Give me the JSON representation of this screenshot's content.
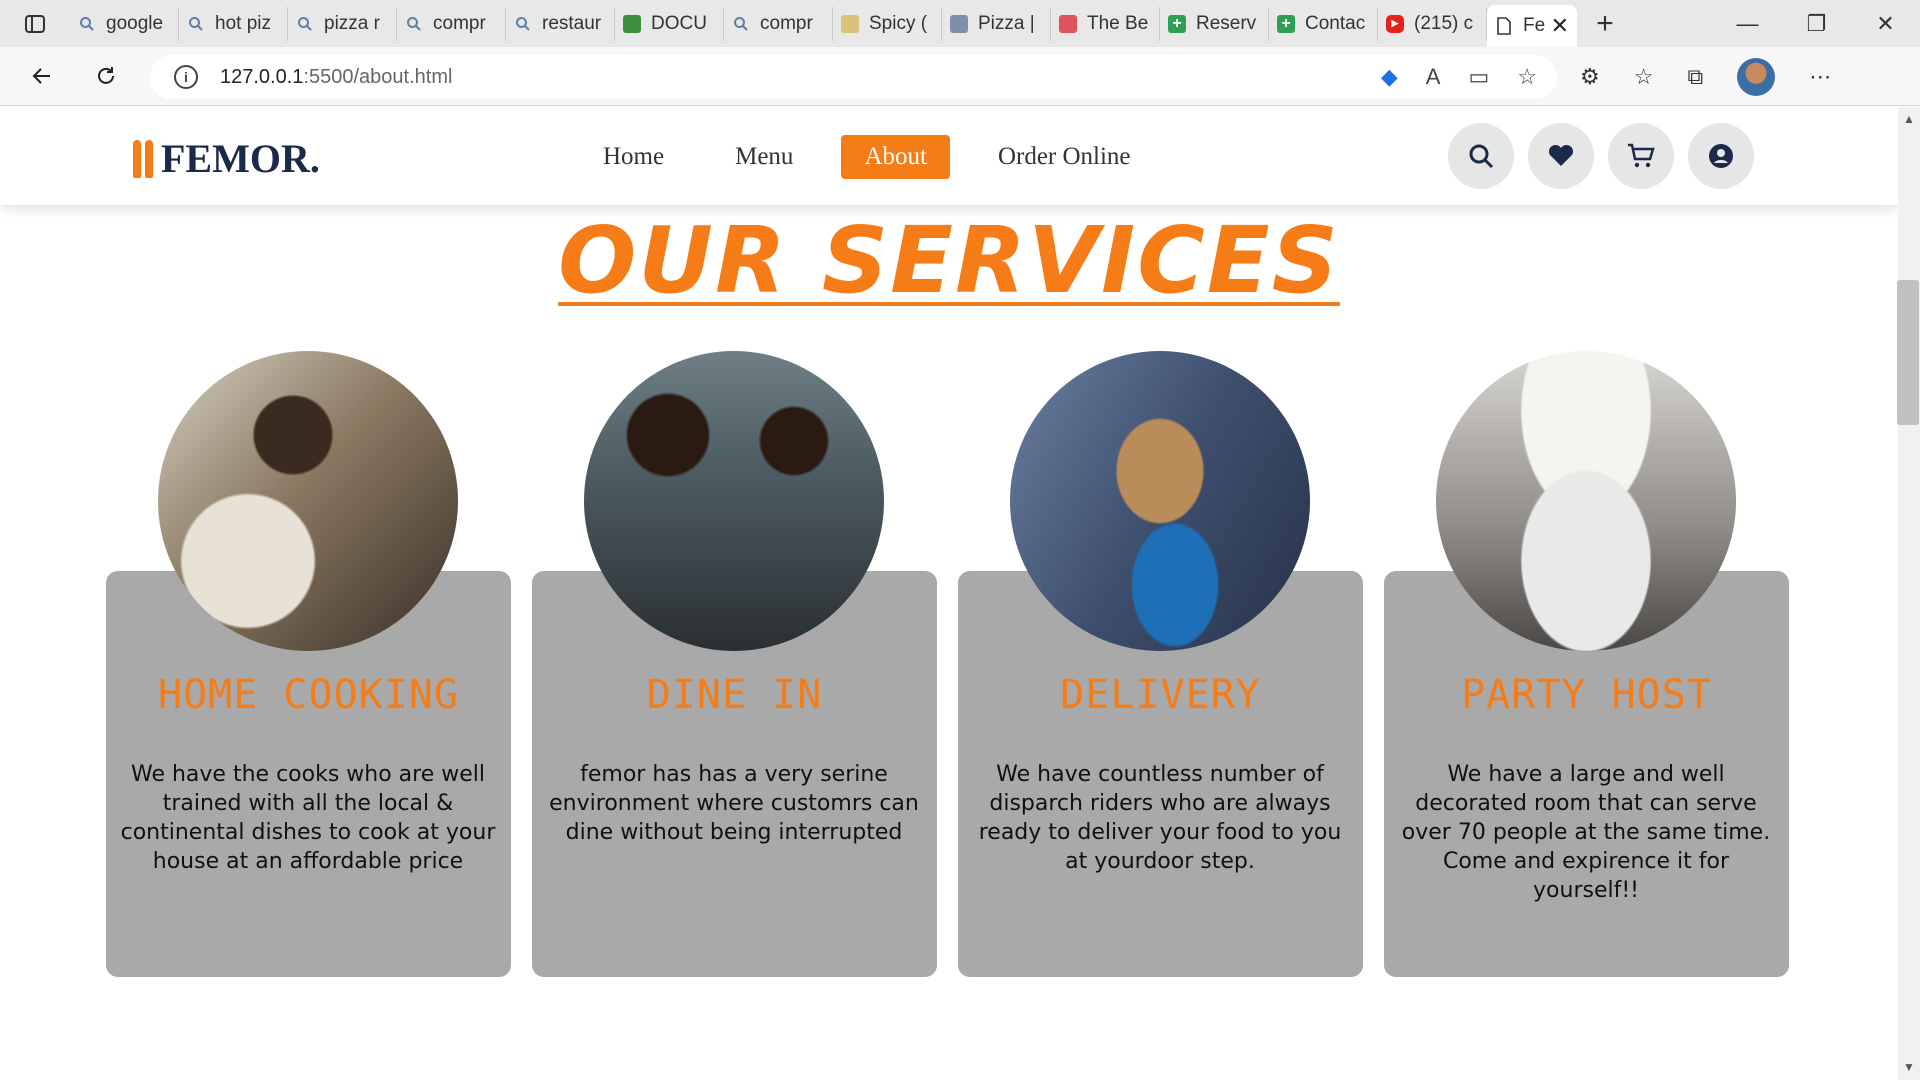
{
  "browser": {
    "tabs": [
      {
        "title": "google",
        "icon": "search-icon",
        "color": "#5f7ea8"
      },
      {
        "title": "hot piz",
        "icon": "search-icon",
        "color": "#5f7ea8"
      },
      {
        "title": "pizza r",
        "icon": "search-icon",
        "color": "#5f7ea8"
      },
      {
        "title": "compr",
        "icon": "search-icon",
        "color": "#5f7ea8"
      },
      {
        "title": "restaur",
        "icon": "search-icon",
        "color": "#5f7ea8"
      },
      {
        "title": "DOCU",
        "icon": "rc-icon",
        "color": "#3c8f3c"
      },
      {
        "title": "compr",
        "icon": "search-icon",
        "color": "#5f7ea8"
      },
      {
        "title": "Spicy (",
        "icon": "page-icon",
        "color": "#d9c27c"
      },
      {
        "title": "Pizza |",
        "icon": "pizza-icon",
        "color": "#7f8faa"
      },
      {
        "title": "The Be",
        "icon": "lr-icon",
        "color": "#e0525c"
      },
      {
        "title": "Reserv",
        "icon": "plus-icon",
        "color": "#2ea055"
      },
      {
        "title": "Contac",
        "icon": "plus-icon",
        "color": "#2ea055"
      },
      {
        "title": "(215) c",
        "icon": "youtube-icon",
        "color": "#e62117"
      }
    ],
    "active_tab": {
      "title": "Fe",
      "icon": "page-icon"
    },
    "url_host": "127.0.0.1",
    "url_path": ":5500/about.html"
  },
  "site": {
    "logo": "FEMOR.",
    "nav": [
      "Home",
      "Menu",
      "About",
      "Order Online"
    ],
    "active_nav": "About",
    "accent": "#f57c16",
    "brand_dark": "#1b2a4a"
  },
  "heading": "OUR SERVICES",
  "services": [
    {
      "title": "HOME COOKING",
      "text": "We have the cooks who are well trained with all the local & continental dishes to cook at your house at an affordable price"
    },
    {
      "title": "DINE IN",
      "text": "femor has has a very serine environment where customrs can dine without being interrupted"
    },
    {
      "title": "DELIVERY",
      "text": "We have countless number of disparch riders who are always ready to deliver your food to you at yourdoor step."
    },
    {
      "title": "PARTY HOST",
      "text": "We have a large and well decorated room that can serve over 70 people at the same time. Come and expirence it for yourself!!"
    }
  ]
}
